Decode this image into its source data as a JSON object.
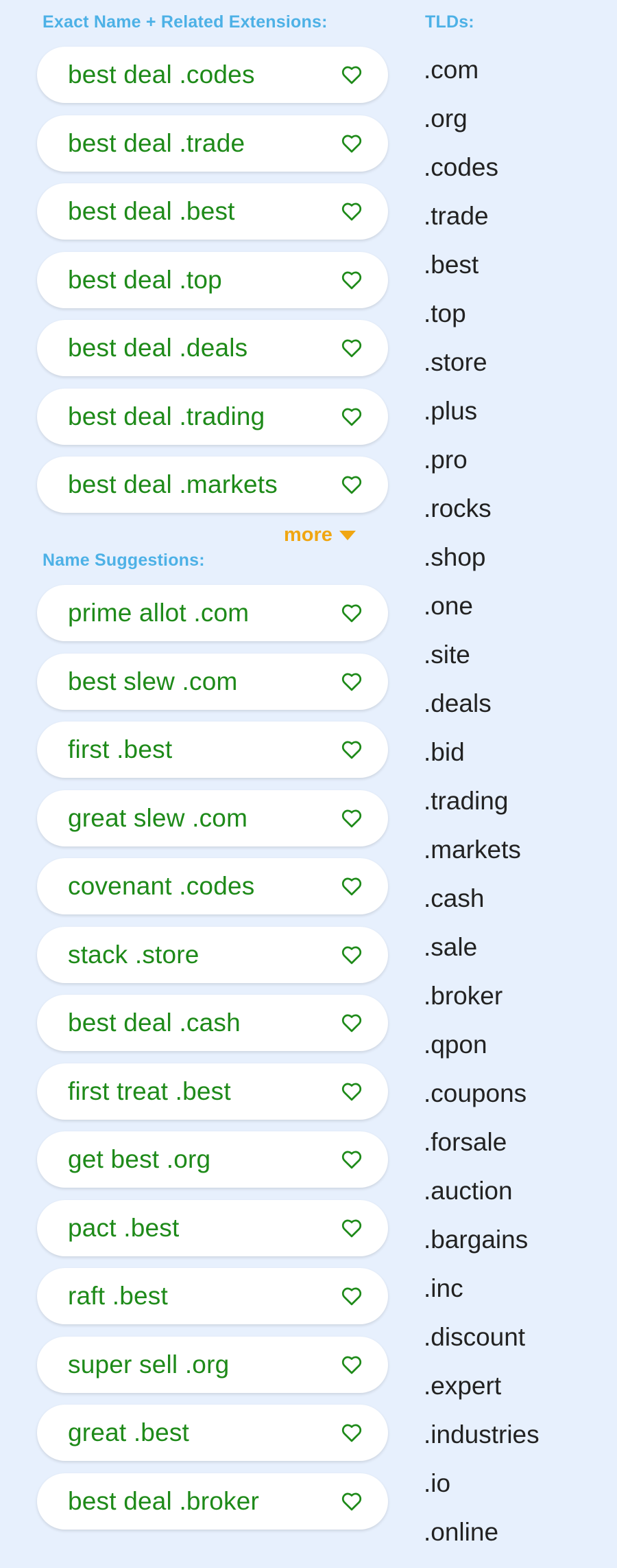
{
  "exact": {
    "label": "Exact Name + Related Extensions:",
    "items": [
      "best deal .codes",
      "best deal .trade",
      "best deal .best",
      "best deal .top",
      "best deal .deals",
      "best deal .trading",
      "best deal .markets"
    ]
  },
  "more_label": "more",
  "suggestions": {
    "label": "Name Suggestions:",
    "items": [
      "prime allot .com",
      "best slew .com",
      "first .best",
      "great slew .com",
      "covenant .codes",
      "stack .store",
      "best deal .cash",
      "first treat .best",
      "get best .org",
      "pact .best",
      "raft .best",
      "super sell .org",
      "great .best",
      "best deal .broker"
    ]
  },
  "tlds": {
    "label": "TLDs:",
    "items": [
      ".com",
      ".org",
      ".codes",
      ".trade",
      ".best",
      ".top",
      ".store",
      ".plus",
      ".pro",
      ".rocks",
      ".shop",
      ".one",
      ".site",
      ".deals",
      ".bid",
      ".trading",
      ".markets",
      ".cash",
      ".sale",
      ".broker",
      ".qpon",
      ".coupons",
      ".forsale",
      ".auction",
      ".bargains",
      ".inc",
      ".discount",
      ".expert",
      ".industries",
      ".io",
      ".online"
    ]
  },
  "colors": {
    "background": "#e7f0fd",
    "section_label": "#4db1e6",
    "domain_text": "#1e8a19",
    "heart": "#1e8a19",
    "more": "#f0a612",
    "tld_text": "#222222"
  },
  "icons": {
    "favorite": "heart-outline-icon",
    "more": "caret-down-icon"
  }
}
